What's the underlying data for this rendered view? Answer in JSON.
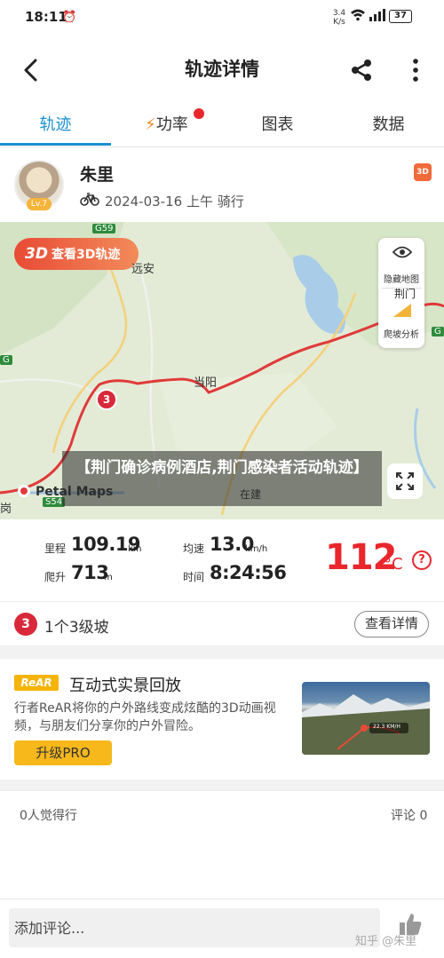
{
  "status_bar": {
    "time": "18:11",
    "net_speed": "3.4",
    "net_unit": "K/s",
    "battery": "37"
  },
  "header": {
    "title": "轨迹详情"
  },
  "tabs": [
    {
      "label": "轨迹",
      "active": true
    },
    {
      "label": "功率",
      "active": false,
      "has_badge": true
    },
    {
      "label": "图表",
      "active": false
    },
    {
      "label": "数据",
      "active": false
    }
  ],
  "user": {
    "name": "朱里",
    "level": "Lv.7",
    "date": "2024-03-16 上午 骑行",
    "badge": "3D"
  },
  "map": {
    "btn_3d_prefix": "3D",
    "btn_3d_label": "查看3D轨迹",
    "hide_map_label": "隐藏地图",
    "slope_analysis_label": "爬坡分析",
    "road_g59": "G59",
    "road_g": "G",
    "road_g2": "G",
    "road_s54": "S54",
    "place_an": "远安",
    "place_dangyang": "当阳",
    "place_jingmen": "荆门",
    "place_gang": "岗",
    "place_zaijian": "在建",
    "marker_3": "3",
    "petal": "Petal Maps",
    "watermark": "【荆门确诊病例酒店,荆门感染者活动轨迹】"
  },
  "stats": {
    "distance_label": "里程",
    "distance_value": "109.19",
    "distance_unit": "km",
    "speed_label": "均速",
    "speed_value": "13.0",
    "speed_unit": "km/h",
    "climb_label": "爬升",
    "climb_value": "713",
    "climb_unit": "m",
    "time_label": "时间",
    "time_value": "8:24:56",
    "temperature_value": "112",
    "temperature_unit": "°C"
  },
  "slope": {
    "badge": "3",
    "text": "1个3级坡",
    "detail_button": "查看详情"
  },
  "rear": {
    "logo": "ReAR",
    "title": "互动式实景回放",
    "description": "行者ReAR将你的户外路线变成炫酷的3D动画视频，与朋友们分享你的户外冒险。",
    "upgrade_button": "升级PRO",
    "preview_text": "22.3 KM/H"
  },
  "comments": {
    "likes": "0人觉得行",
    "count": "评论 0"
  },
  "input": {
    "placeholder": "添加评论..."
  },
  "watermark_footer": "知乎 @朱里",
  "colors": {
    "accent_blue": "#1a8fd0",
    "route_red": "#e03a3a",
    "temperature_red": "#e8262c",
    "rear_yellow": "#f7b81c"
  }
}
